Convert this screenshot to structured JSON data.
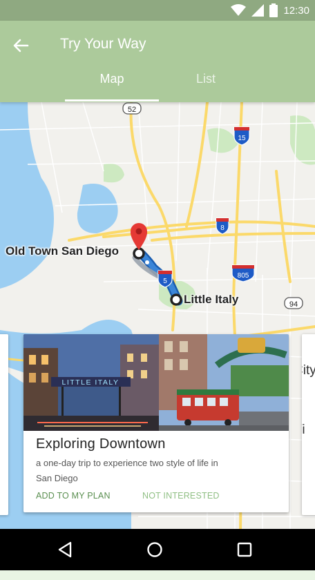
{
  "status_bar": {
    "time": "12:30",
    "icons": [
      "wifi-icon",
      "signal-icon",
      "battery-icon"
    ]
  },
  "app_bar": {
    "title": "Try Your Way",
    "back_icon": "arrow-back-icon"
  },
  "tabs": [
    {
      "label": "Map",
      "selected": true
    },
    {
      "label": "List",
      "selected": false
    }
  ],
  "map": {
    "labels": {
      "start": "Old Town San Diego",
      "end": "Little Italy"
    },
    "road_shields": {
      "r52": "52",
      "i15": "15",
      "i8": "8",
      "i5": "5",
      "i805": "805",
      "r94": "94"
    }
  },
  "card": {
    "title": "Exploring Downtown",
    "description": "a one-day trip to experience two style of life in San Diego",
    "sign_text": "LITTLE ITALY",
    "add_label": "ADD TO MY PLAN",
    "dismiss_label": "NOT INTERESTED"
  },
  "side_card_right": {
    "text_fragment_1": "City",
    "text_fragment_2": "Vi"
  },
  "nav_bar": {
    "icons": [
      "back-triangle-icon",
      "home-circle-icon",
      "recents-square-icon"
    ]
  },
  "colors": {
    "status_bar": "#8fa981",
    "app_bar": "#acca9b",
    "accent_green": "#5a8f50",
    "map_water": "#9ccef2",
    "map_land": "#f2f1ed",
    "route": "#3a85d8"
  }
}
